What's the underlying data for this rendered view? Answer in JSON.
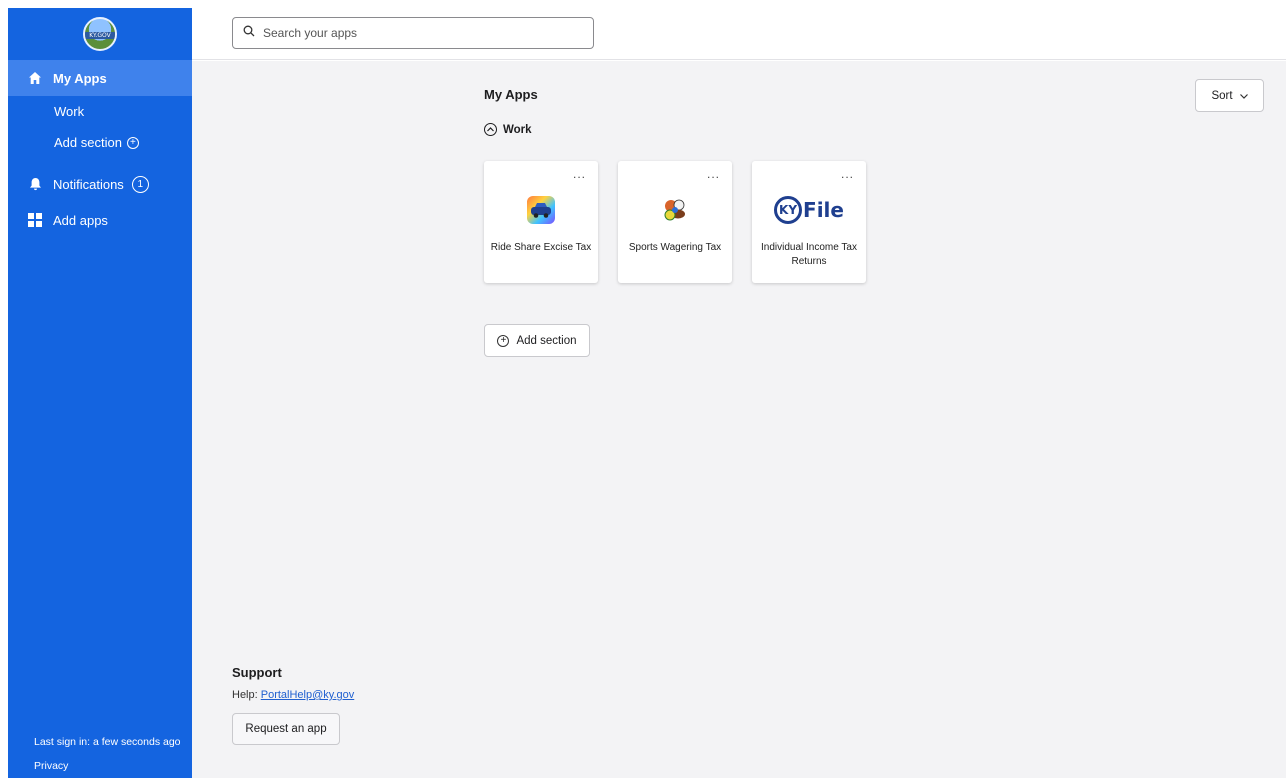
{
  "sidebar": {
    "logo_text": "KY.GOV",
    "items": [
      {
        "label": "My Apps",
        "icon": "home-icon"
      },
      {
        "label": "Work"
      },
      {
        "label": "Add section"
      },
      {
        "label": "Notifications",
        "badge": "1",
        "icon": "bell-icon"
      },
      {
        "label": "Add apps",
        "icon": "grid-icon"
      }
    ],
    "footer": {
      "last_sign_in": "Last sign in: a few seconds ago",
      "privacy": "Privacy"
    }
  },
  "search": {
    "placeholder": "Search your apps"
  },
  "main": {
    "title": "My Apps",
    "sort_label": "Sort",
    "section_title": "Work",
    "apps": [
      {
        "name": "Ride Share Excise Tax",
        "more": "..."
      },
      {
        "name": "Sports Wagering Tax",
        "more": "..."
      },
      {
        "name": "Individual Income Tax Returns",
        "more": "...",
        "logo_text_ky": "KY",
        "logo_text_file": "File"
      }
    ],
    "add_section_label": "Add section"
  },
  "support": {
    "title": "Support",
    "help_prefix": "Help:",
    "help_email": "PortalHelp@ky.gov",
    "request_label": "Request an app"
  },
  "colors": {
    "sidebar": "#1464e0",
    "sidebar_active": "#3f82ec",
    "main_bg": "#f3f3f5"
  }
}
